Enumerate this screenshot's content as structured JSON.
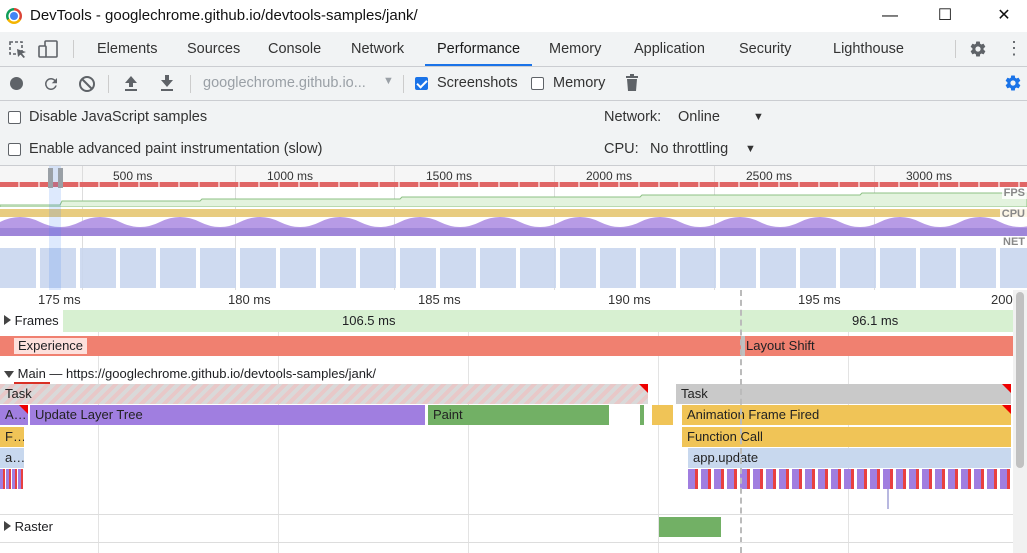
{
  "window": {
    "title": "DevTools - googlechrome.github.io/devtools-samples/jank/",
    "minimize": "—",
    "maximize": "☐",
    "close": "✕"
  },
  "tabs": [
    "Elements",
    "Sources",
    "Console",
    "Network",
    "Performance",
    "Memory",
    "Application",
    "Security",
    "Lighthouse"
  ],
  "active_tab": "Performance",
  "toolbar": {
    "profile_select": "googlechrome.github.io...",
    "screenshots_label": "Screenshots",
    "screenshots_checked": true,
    "memory_label": "Memory",
    "memory_checked": false
  },
  "settings": {
    "disable_js_samples": "Disable JavaScript samples",
    "advanced_paint": "Enable advanced paint instrumentation (slow)",
    "network_label": "Network:",
    "network_value": "Online",
    "cpu_label": "CPU:",
    "cpu_value": "No throttling"
  },
  "overview": {
    "ticks": [
      "500 ms",
      "1000 ms",
      "1500 ms",
      "2000 ms",
      "2500 ms",
      "3000 ms"
    ],
    "tracks": [
      "FPS",
      "CPU",
      "NET"
    ]
  },
  "flame": {
    "ticks": [
      "175 ms",
      "180 ms",
      "185 ms",
      "190 ms",
      "195 ms",
      "200"
    ],
    "frames_label": "Frames",
    "frame_durations": [
      "106.5 ms",
      "96.1 ms"
    ],
    "experience_label": "Experience",
    "layout_shift": "Layout Shift",
    "main_label": "Main",
    "main_url": " — https://googlechrome.github.io/devtools-samples/jank/",
    "task1": "Task",
    "task2": "Task",
    "row2_a": "A…",
    "update_layer_tree": "Update Layer Tree",
    "paint": "Paint",
    "animation_frame_fired": "Animation Frame Fired",
    "row3_f": "F…",
    "function_call": "Function Call",
    "row4_a": "a…",
    "app_update": "app.update",
    "raster_label": "Raster"
  },
  "colors": {
    "accent": "#1a73e8",
    "frames": "#d7f0d1",
    "experience": "#f08070",
    "task": "#c9c9c9",
    "rendering": "#a07ee0",
    "painting": "#72b065",
    "scripting": "#f0c457",
    "app_update": "#c8d8ee"
  }
}
